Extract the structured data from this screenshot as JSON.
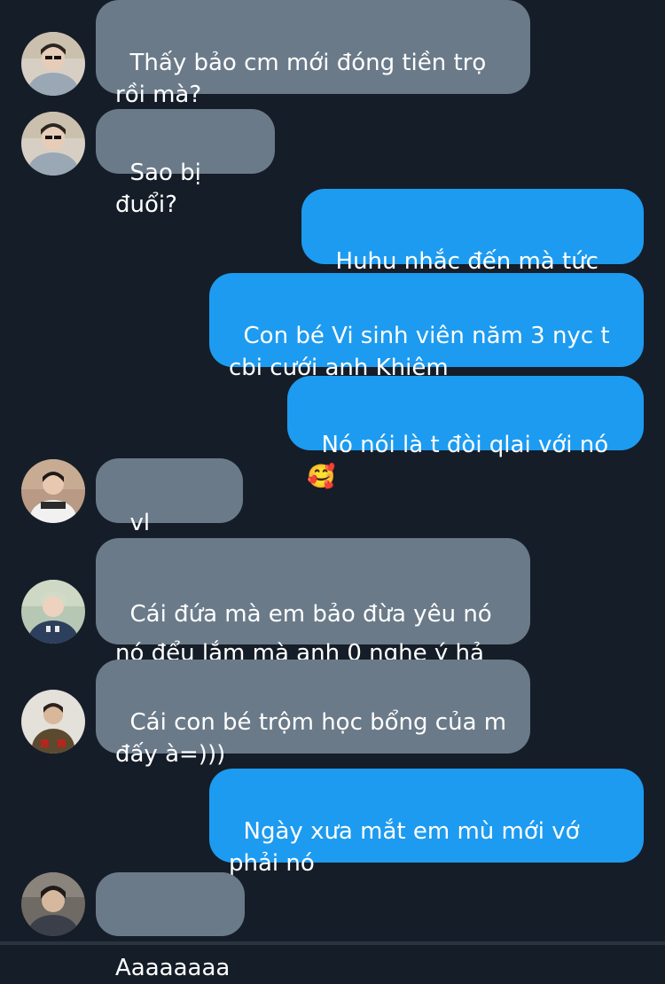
{
  "messages": [
    {
      "sender": "contact-1",
      "direction": "incoming",
      "text": "Thấy bảo cm mới đóng tiền trọ rồi mà?"
    },
    {
      "sender": "contact-1",
      "direction": "incoming",
      "text": "Sao bị đuổi?"
    },
    {
      "sender": "me",
      "direction": "outgoing",
      "text": "Huhu nhắc đến mà tức 😭"
    },
    {
      "sender": "me",
      "direction": "outgoing",
      "text": "Con bé Vi sinh viên năm 3 nyc t cbi cưới anh Khiêm"
    },
    {
      "sender": "me",
      "direction": "outgoing",
      "text": "Nó nói là t đòi qlai với nó🥰"
    },
    {
      "sender": "contact-2",
      "direction": "incoming",
      "text": "vl kay=)))"
    },
    {
      "sender": "contact-3",
      "direction": "incoming",
      "text": "Cái đứa mà em bảo đừa yêu nó nó đểu lắm mà anh 0 nghe ý hả 🤨"
    },
    {
      "sender": "contact-4",
      "direction": "incoming",
      "text": "Cái con bé trộm học bổng của m đấy à=)))"
    },
    {
      "sender": "me",
      "direction": "outgoing",
      "text": "Ngày xưa mắt em mù mới vớ phải nó"
    },
    {
      "sender": "contact-5",
      "direction": "incoming",
      "text": "Aaaaaaaa"
    }
  ],
  "colors": {
    "background": "#151d28",
    "incoming_bubble": "#6a7a89",
    "outgoing_bubble": "#1d9bf0",
    "text": "#ffffff"
  }
}
